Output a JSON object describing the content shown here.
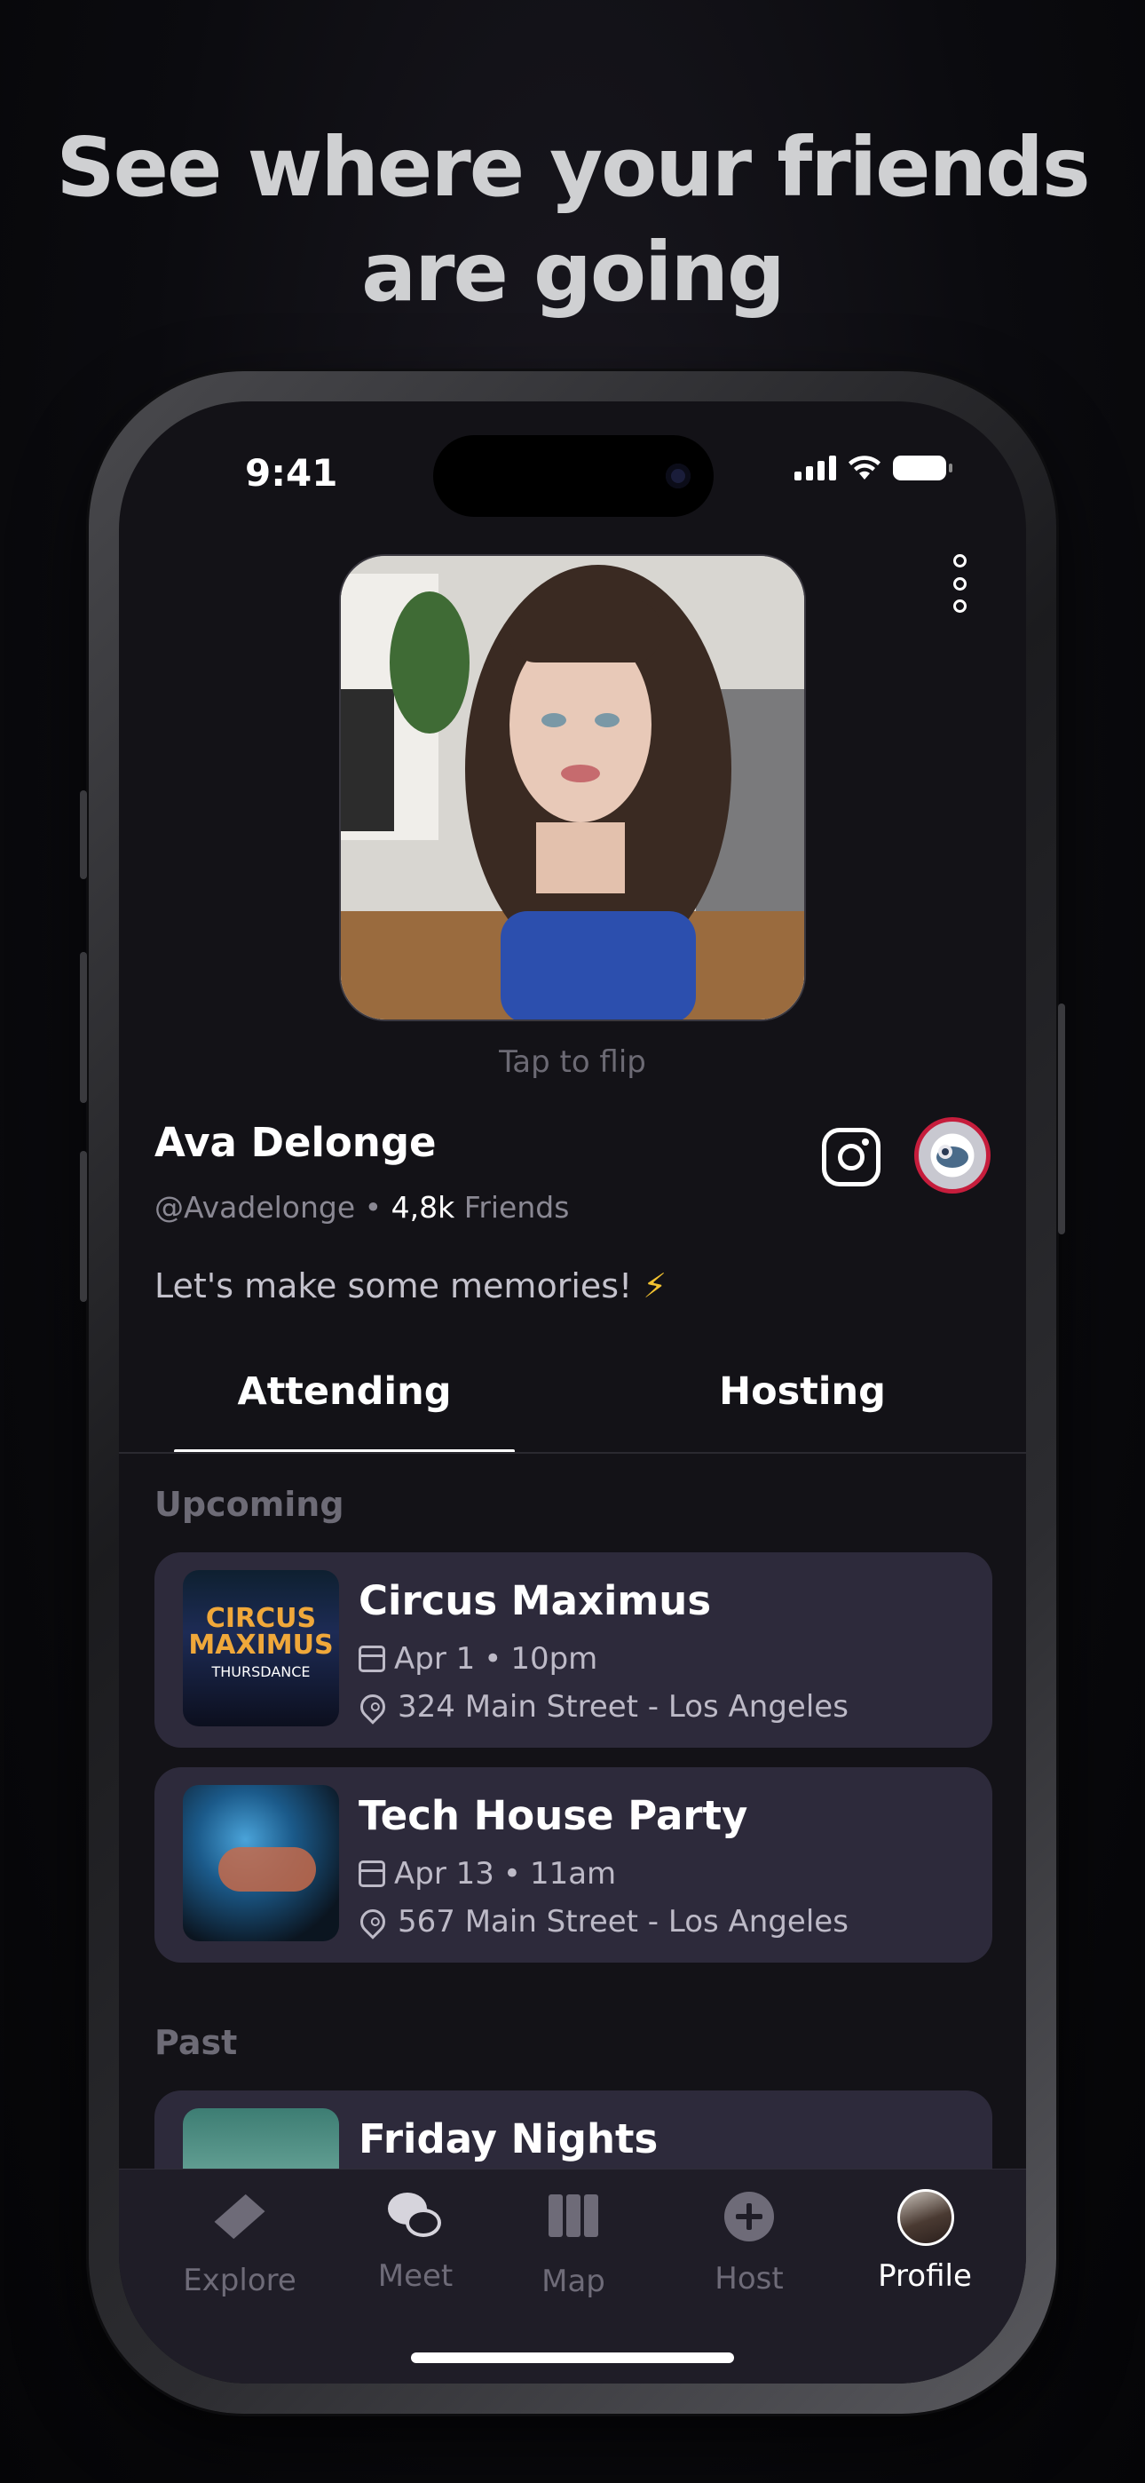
{
  "headline": {
    "line1": "See where your friends",
    "line2": "are going"
  },
  "status_bar": {
    "time": "9:41"
  },
  "profile": {
    "tap_to_flip": "Tap to flip",
    "name": "Ava Delonge",
    "handle": "@Avadelonge",
    "separator": "•",
    "friends_count": "4,8k",
    "friends_label": "Friends",
    "bio": "Let's make some memories!",
    "bio_emoji": "⚡"
  },
  "tabs": [
    {
      "label": "Attending",
      "active": true
    },
    {
      "label": "Hosting",
      "active": false
    }
  ],
  "sections": {
    "upcoming": "Upcoming",
    "past": "Past"
  },
  "events_upcoming": [
    {
      "title": "Circus Maximus",
      "date": "Apr 1",
      "dot": "•",
      "time": "10pm",
      "address": "324 Main Street - Los Angeles",
      "thumb_text": "CIRCUS MAXIMUS",
      "thumb_sub": "THURSDANCE"
    },
    {
      "title": "Tech House Party",
      "date": "Apr 13",
      "dot": "•",
      "time": "11am",
      "address": "567 Main Street - Los Angeles"
    }
  ],
  "events_past": [
    {
      "title": "Friday Nights"
    }
  ],
  "nav": [
    {
      "label": "Explore",
      "icon": "compass-icon",
      "active": false
    },
    {
      "label": "Meet",
      "icon": "chat-bubbles-icon",
      "active": false
    },
    {
      "label": "Map",
      "icon": "map-icon",
      "active": false
    },
    {
      "label": "Host",
      "icon": "plus-circle-icon",
      "active": false
    },
    {
      "label": "Profile",
      "icon": "avatar-icon",
      "active": true
    }
  ],
  "colors": {
    "background": "#131217",
    "card": "#2d2a3b",
    "badge_ring": "#c61d3c",
    "muted_text": "#6e6b78",
    "bolt": "#f2c230"
  }
}
